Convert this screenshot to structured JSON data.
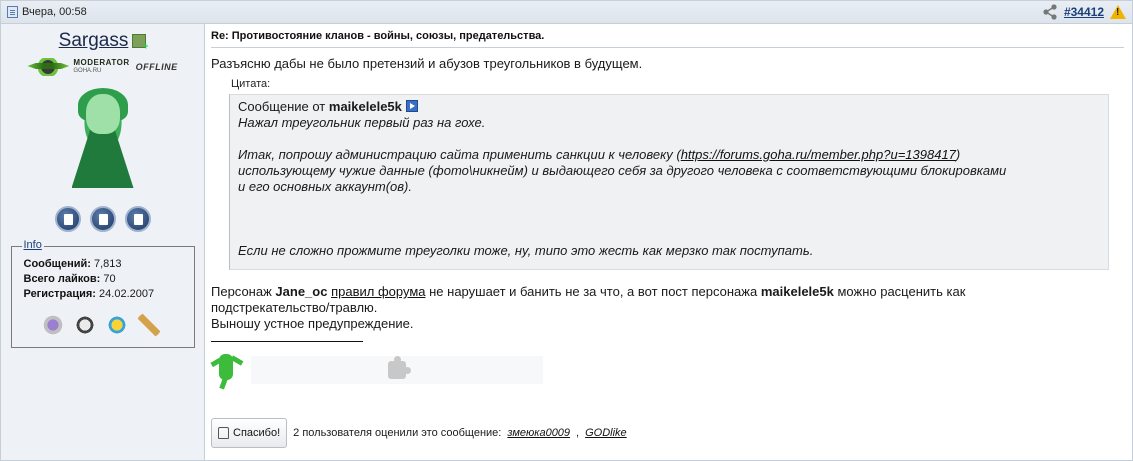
{
  "header": {
    "date": "Вчера, 00:58",
    "post_number": "#34412",
    "warn_symbol": "!"
  },
  "user": {
    "name": "Sargass",
    "badge_title": "MODERATOR",
    "badge_site": "GOHA.RU",
    "status": "OFFLINE",
    "info_title": "Info",
    "messages_label": "Сообщений:",
    "messages_value": "7,813",
    "likes_label": "Всего лайков:",
    "likes_value": "70",
    "reg_label": "Регистрация:",
    "reg_value": "24.02.2007"
  },
  "post": {
    "title": "Re: Противостояние кланов - войны, союзы, предательства.",
    "intro": "Разъясню дабы не было претензий и абузов треугольников в будущем.",
    "quote_label": "Цитата:",
    "quote_from_prefix": "Сообщение от",
    "quote_from_user": "maikelele5k",
    "quote_line1": "Нажал треугольник первый раз на гохе.",
    "quote_line2_pre": "Итак, попрошу администрацию сайта применить санкции к человеку (",
    "quote_link": "https://forums.goha.ru/member.php?u=1398417",
    "quote_line2_post": ")",
    "quote_line3": "использующему чужие данные (фото\\никнейм) и выдающего себя за другого человека с соответствующими блокировками",
    "quote_line4": "и его основных аккаунт(ов).",
    "quote_line5": "Если не сложно прожмите треуголки тоже, ну, типо это жесть как мерзко так поступать.",
    "reply_p1": "Персонаж",
    "reply_user1": "Jane_oc",
    "reply_link": "правил форума",
    "reply_p2": "не нарушает и банить не за что, а вот пост персонажа",
    "reply_user2": "maikelele5k",
    "reply_p3": "можно расценить как",
    "reply_line2": "подстрекательство/травлю.",
    "reply_line3": "Выношу устное предупреждение."
  },
  "thanks": {
    "button_label": "Спасибо!",
    "text": "2 пользователя оценили это сообщение:",
    "user1": "змеюка0009",
    "separator": ",",
    "user2": "GODlike"
  }
}
